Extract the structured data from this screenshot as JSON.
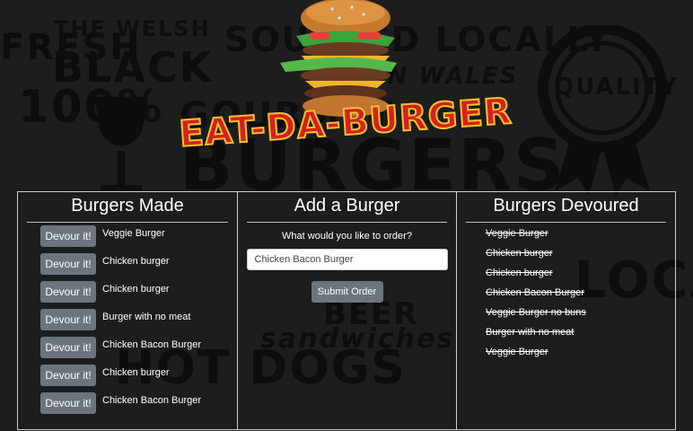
{
  "logo": {
    "text": "EAT-DA-BURGER"
  },
  "background_words": [
    "THE WELSH",
    "BLACK",
    "SOURCED LOCALLY",
    "IN WALES",
    "QUALITY",
    "GOURMET",
    "BURGERS",
    "HOT DOGS",
    "100%",
    "FRESH",
    "BEER",
    "sandwiches",
    "LOCAL"
  ],
  "made": {
    "title": "Burgers Made",
    "button_label": "Devour it!",
    "items": [
      "Veggie Burger",
      "Chicken burger",
      "Chicken burger",
      "Burger with no meat",
      "Chicken Bacon Burger",
      "Chicken burger",
      "Chicken Bacon Burger"
    ]
  },
  "add": {
    "title": "Add a Burger",
    "prompt": "What would you like to order?",
    "input_value": "Chicken Bacon Burger",
    "submit_label": "Submit Order"
  },
  "devoured": {
    "title": "Burgers Devoured",
    "items": [
      "Veggie Burger",
      "Chicken burger",
      "Chicken burger",
      "Chicken Bacon Burger",
      "Veggie Burger no buns",
      "Burger with no meat",
      "Veggie Burger"
    ]
  },
  "colors": {
    "background": "#1d1d1d",
    "button": "#6c757d",
    "logo_text": "#d6201f",
    "logo_outline": "#f2c32a"
  }
}
